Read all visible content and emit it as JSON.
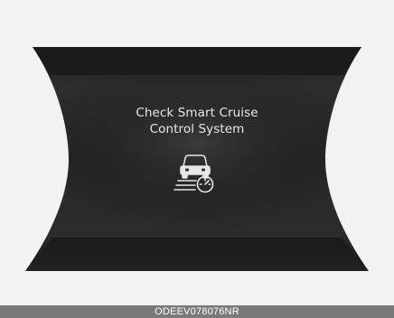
{
  "display": {
    "message_line1": "Check Smart Cruise",
    "message_line2": "Control System",
    "icon": "smart-cruise-control-warning-icon",
    "text_color": "#e9e9e9",
    "panel_color": "#2a2a2a",
    "frame_color": "#f2f2f2"
  },
  "caption": {
    "code": "ODEEV078076NR",
    "bar_color": "#7a7a7a"
  }
}
